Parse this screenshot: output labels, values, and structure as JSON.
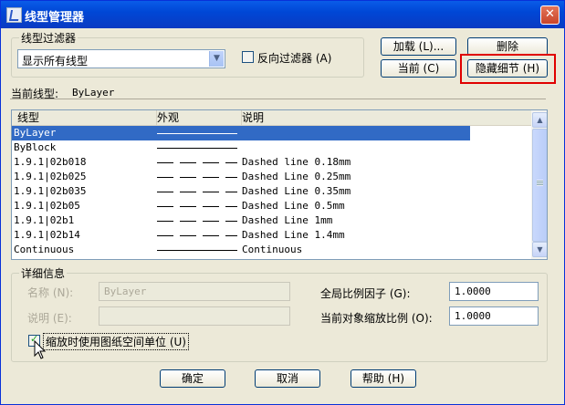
{
  "window": {
    "title": "线型管理器",
    "close_glyph": "✕"
  },
  "filter": {
    "group_label": "线型过滤器",
    "selected": "显示所有线型",
    "invert_label": "反向过滤器 (A)"
  },
  "buttons": {
    "load": "加载 (L)...",
    "delete": "删除",
    "current": "当前 (C)",
    "hide_details": "隐藏细节 (H)",
    "ok": "确定",
    "cancel": "取消",
    "help": "帮助 (H)"
  },
  "current_linetype": {
    "label": "当前线型:",
    "value": "ByLayer"
  },
  "list": {
    "headers": [
      "线型",
      "外观",
      "说明"
    ],
    "rows": [
      {
        "name": "ByLayer",
        "appearance": "solid",
        "description": ""
      },
      {
        "name": "ByBlock",
        "appearance": "solid",
        "description": ""
      },
      {
        "name": "1.9.1|02b018",
        "appearance": "dashed",
        "description": "Dashed line 0.18mm"
      },
      {
        "name": "1.9.1|02b025",
        "appearance": "dashed",
        "description": "Dashed Line 0.25mm"
      },
      {
        "name": "1.9.1|02b035",
        "appearance": "dashed",
        "description": "Dashed Line 0.35mm"
      },
      {
        "name": "1.9.1|02b05",
        "appearance": "dashed",
        "description": "Dashed Line 0.5mm"
      },
      {
        "name": "1.9.1|02b1",
        "appearance": "dashed",
        "description": "Dashed Line 1mm"
      },
      {
        "name": "1.9.1|02b14",
        "appearance": "dashed",
        "description": "Dashed Line 1.4mm"
      },
      {
        "name": "Continuous",
        "appearance": "solid",
        "description": "Continuous"
      }
    ],
    "selected_index": 0
  },
  "details": {
    "group_label": "详细信息",
    "name_label": "名称 (N):",
    "name_value": "ByLayer",
    "desc_label": "说明 (E):",
    "desc_value": "",
    "global_scale_label": "全局比例因子 (G):",
    "global_scale_value": "1.0000",
    "current_scale_label": "当前对象缩放比例 (O):",
    "current_scale_value": "1.0000",
    "paper_units_label": "缩放时使用图纸空间单位 (U)"
  }
}
